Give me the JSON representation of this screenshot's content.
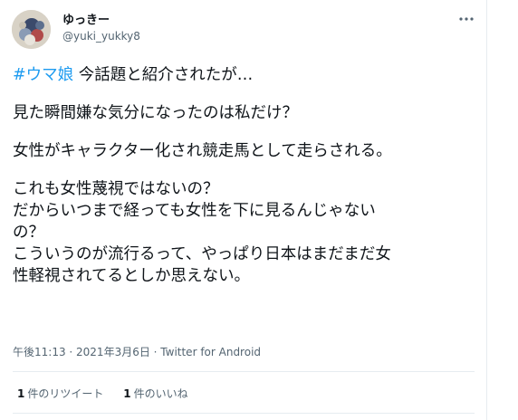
{
  "user": {
    "display_name": "ゆっきー",
    "handle": "@yuki_yukky8"
  },
  "tweet": {
    "hashtag": "#ウマ娘",
    "first_line_rest": " 今話題と紹介されたが…",
    "lines_block2": [
      "見た瞬間嫌な気分になったのは私だけ？"
    ],
    "lines_block3": [
      "女性がキャラクター化され競走馬として走らされる。"
    ],
    "lines_block4": [
      "これも女性蔑視ではないの？",
      "だからいつまで経っても女性を下に見るんじゃない",
      "の？",
      "こういうのが流行るって、やっぱり日本はまだまだ女",
      "性軽視されてるとしか思えない。"
    ]
  },
  "meta": {
    "time_date": "午後11:13 · 2021年3月6日 · ",
    "source": "Twitter for Android"
  },
  "stats": {
    "retweets_num": "1",
    "retweets_label": "件のリツイート",
    "likes_num": "1",
    "likes_label": "件のいいね"
  },
  "icons": {
    "more": "more-horizontal-icon"
  },
  "colors": {
    "link": "#1d9bf0",
    "text": "#0f1419",
    "secondary": "#536471",
    "border": "#e6ecf0"
  }
}
